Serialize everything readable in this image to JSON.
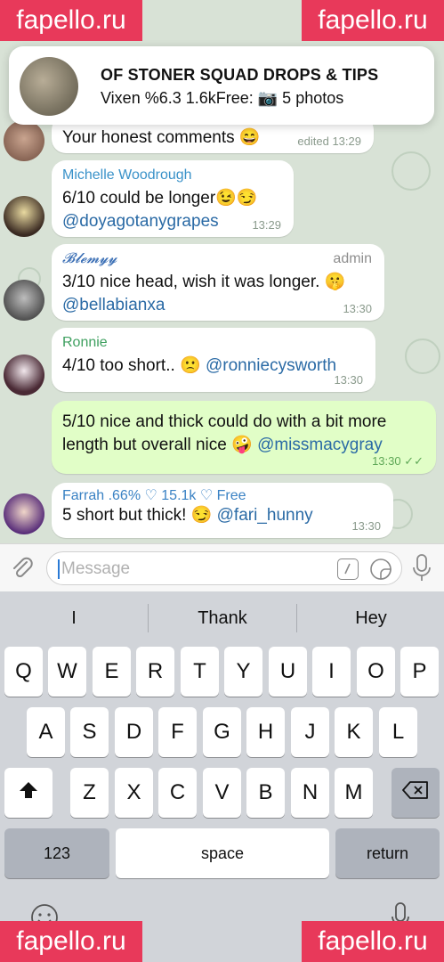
{
  "watermark": "fapello.ru",
  "notification": {
    "title": "OF STONER SQUAD DROPS & TIPS",
    "body": "Vixen %6.3 1.6kFree: 📷 5 photos"
  },
  "messages": [
    {
      "text": "Your honest comments 😄",
      "time": "edited 13:29"
    },
    {
      "sender": "Michelle Woodrough",
      "sender_color": "#3a92c9",
      "text": "6/10 could be longer😉😏",
      "mention": "@doyagotanygrapes",
      "time": "13:29"
    },
    {
      "sender": "𝓑𝓵𝓮𝓶𝔂𝔂",
      "sender_color": "#3b6fb5",
      "badge": "admin",
      "text": "3/10 nice head, wish it was longer. 🤫",
      "mention": "@bellabianxa",
      "time": "13:30"
    },
    {
      "sender": "Ronnie",
      "sender_color": "#3fa060",
      "text": "4/10 too short.. 🙁",
      "mention": "@ronniecysworth",
      "time": "13:30"
    },
    {
      "text": "5/10 nice and thick could do with a bit more length but overall nice 🤪",
      "mention": "@missmacygray",
      "time": "13:30 ✓✓"
    },
    {
      "sender": "Farrah .66% ♡ 15.1k ♡ Free",
      "sender_color": "#3a82c4",
      "text": "5 short but thick! 😏",
      "mention": "@fari_hunny",
      "time": "13:30"
    }
  ],
  "input": {
    "placeholder": "Message"
  },
  "keyboard": {
    "suggestions": [
      "I",
      "Thank",
      "Hey"
    ],
    "row1": [
      "Q",
      "W",
      "E",
      "R",
      "T",
      "Y",
      "U",
      "I",
      "O",
      "P"
    ],
    "row2": [
      "A",
      "S",
      "D",
      "F",
      "G",
      "H",
      "J",
      "K",
      "L"
    ],
    "row3": [
      "Z",
      "X",
      "C",
      "V",
      "B",
      "N",
      "M"
    ],
    "numbers_key": "123",
    "space_key": "space",
    "return_key": "return"
  }
}
